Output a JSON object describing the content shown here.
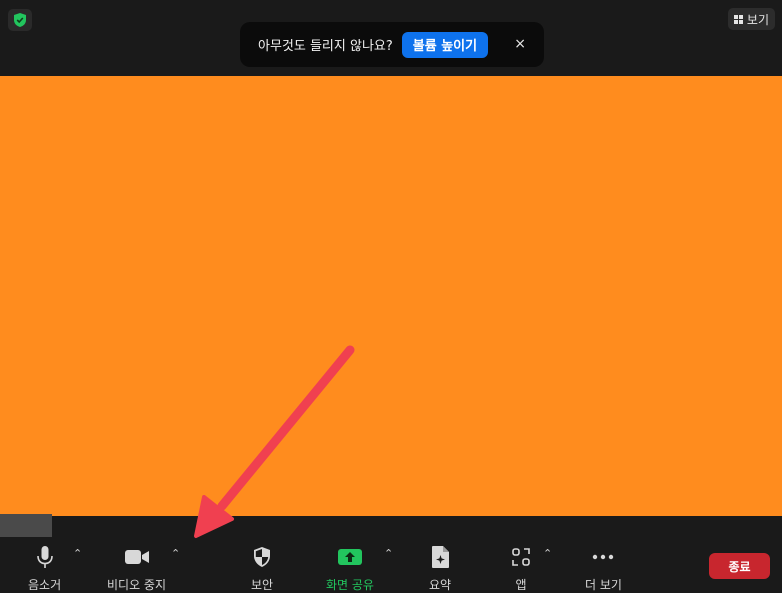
{
  "top": {
    "view_label": "보기"
  },
  "toast": {
    "message": "아무것도 들리지 않나요?",
    "button_label": "볼륨 높이기",
    "close_symbol": "×"
  },
  "toolbar": {
    "mute_label": "음소거",
    "video_label": "비디오 중지",
    "security_label": "보안",
    "share_label": "화면 공유",
    "summary_label": "요약",
    "apps_label": "앱",
    "more_label": "더 보기",
    "end_label": "종료",
    "caret_symbol": "⌃"
  },
  "colors": {
    "video_background": "#ff8c1e",
    "share_accent": "#22c55e",
    "end_button": "#c8262e",
    "toast_button": "#0e72ed",
    "annotation_arrow": "#f04050"
  }
}
